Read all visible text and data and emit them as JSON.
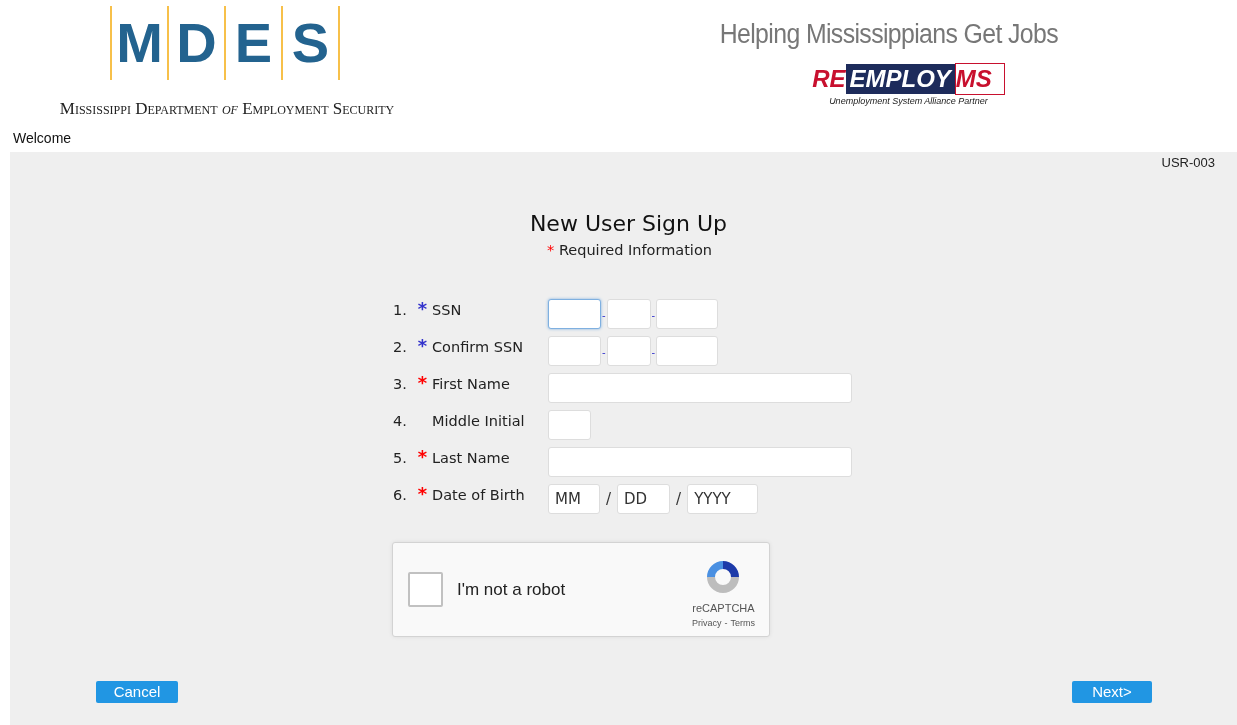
{
  "header": {
    "logo_letters": [
      "M",
      "D",
      "E",
      "S"
    ],
    "agency": "Mississippi Department *of* Employment Security",
    "tagline": "Helping Mississippians Get Jobs",
    "partner_logo": {
      "re": "RE",
      "employ": "EMPLOY",
      "ms": "MS",
      "caption": "Unemployment System Alliance Partner"
    }
  },
  "welcome": "Welcome",
  "screen_id": "USR-003",
  "form": {
    "title": "New User Sign Up",
    "required_mark": "*",
    "required_note": "Required Information",
    "fields": [
      {
        "number": "1.",
        "mark": "*",
        "color": "#3333cc",
        "label": "SSN",
        "kind": "ssn",
        "separator": "-",
        "focused": true
      },
      {
        "number": "2.",
        "mark": "*",
        "color": "#3333cc",
        "label": "Confirm SSN",
        "kind": "ssn",
        "separator": "-",
        "focused": false
      },
      {
        "number": "3.",
        "mark": "*",
        "color": "#ff0000",
        "label": "First Name",
        "kind": "text",
        "focused": false
      },
      {
        "number": "4.",
        "label": "Middle Initial",
        "kind": "initial",
        "focused": false
      },
      {
        "number": "5.",
        "mark": "*",
        "color": "#ff0000",
        "label": "Last Name",
        "kind": "text",
        "focused": false
      },
      {
        "number": "6.",
        "mark": "*",
        "color": "#ff0000",
        "label": "Date of Birth",
        "kind": "date",
        "separator": "/",
        "placeholders": [
          "MM",
          "DD",
          "YYYY"
        ],
        "focused": false
      }
    ]
  },
  "captcha": {
    "label": "I'm not a robot",
    "checked": false,
    "brand": "reCAPTCHA",
    "privacy": "Privacy",
    "dash": "-",
    "terms": "Terms"
  },
  "buttons": {
    "cancel": "Cancel",
    "next": "Next>"
  }
}
